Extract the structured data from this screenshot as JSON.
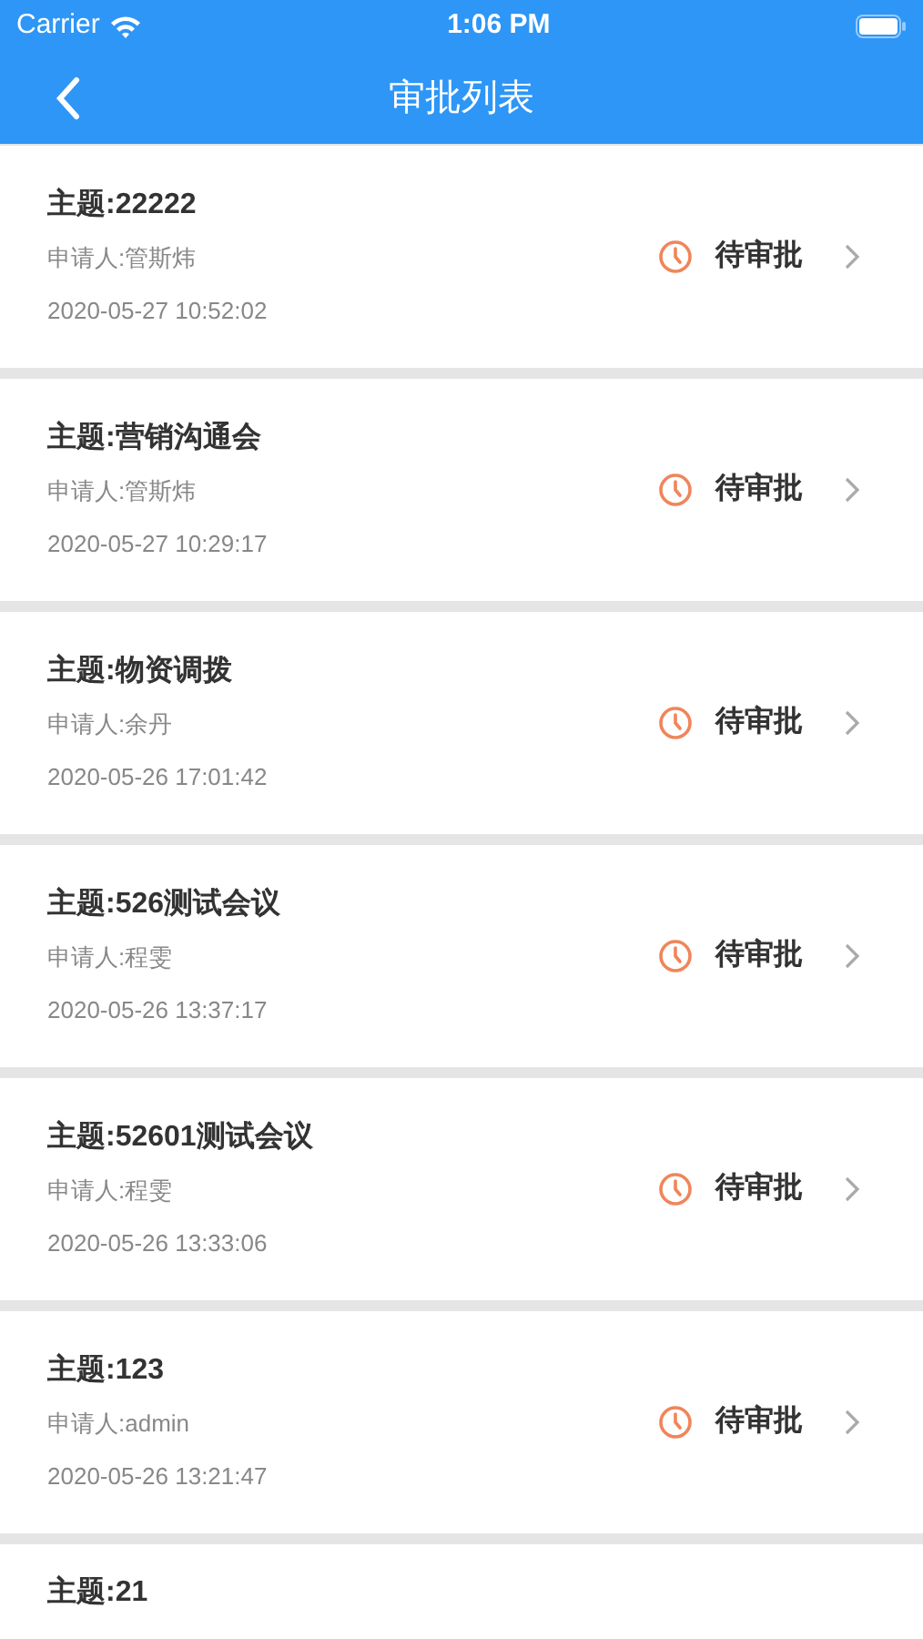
{
  "status_bar": {
    "carrier": "Carrier",
    "time": "1:06 PM"
  },
  "nav": {
    "title": "审批列表"
  },
  "items": [
    {
      "subject": "主题:22222",
      "applicant": "申请人:管斯炜",
      "time": "2020-05-27 10:52:02",
      "status": "待审批"
    },
    {
      "subject": "主题:营销沟通会",
      "applicant": "申请人:管斯炜",
      "time": "2020-05-27 10:29:17",
      "status": "待审批"
    },
    {
      "subject": "主题:物资调拨",
      "applicant": "申请人:余丹",
      "time": "2020-05-26 17:01:42",
      "status": "待审批"
    },
    {
      "subject": "主题:526测试会议",
      "applicant": "申请人:程雯",
      "time": "2020-05-26 13:37:17",
      "status": "待审批"
    },
    {
      "subject": "主题:52601测试会议",
      "applicant": "申请人:程雯",
      "time": "2020-05-26 13:33:06",
      "status": "待审批"
    },
    {
      "subject": "主题:123",
      "applicant": "申请人:admin",
      "time": "2020-05-26 13:21:47",
      "status": "待审批"
    },
    {
      "subject": "主题:21"
    }
  ]
}
